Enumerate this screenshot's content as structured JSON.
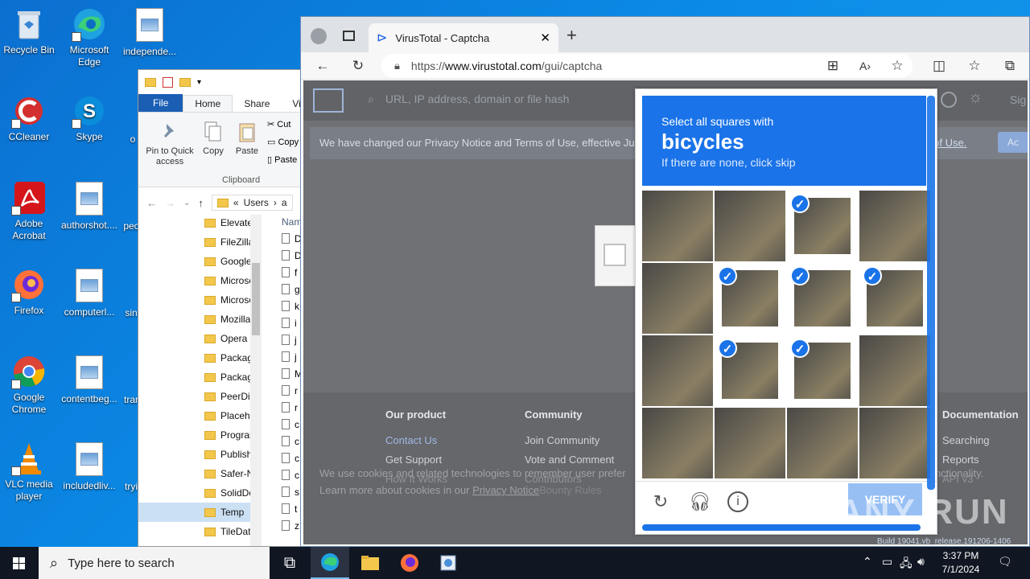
{
  "desktop": {
    "icons": [
      {
        "label": "Recycle Bin"
      },
      {
        "label": "Microsoft Edge"
      },
      {
        "label": "independe..."
      },
      {
        "label": "CCleaner"
      },
      {
        "label": "Skype"
      },
      {
        "label": "Adobe Acrobat"
      },
      {
        "label": "authorshot...."
      },
      {
        "label": "Firefox"
      },
      {
        "label": "computerl..."
      },
      {
        "label": "Google Chrome"
      },
      {
        "label": "contentbeg..."
      },
      {
        "label": "VLC media player"
      },
      {
        "label": "includedliv..."
      }
    ],
    "partial_labels": [
      "o",
      "pec",
      "sin",
      "trar",
      "tryi"
    ]
  },
  "explorer": {
    "tabs": [
      "File",
      "Home",
      "Share",
      "Vie"
    ],
    "ribbon": {
      "pin_label": "Pin to Quick access",
      "copy_label": "Copy",
      "paste_label": "Paste",
      "cut_label": "Cut",
      "copy_path_label": "Copy",
      "paste_shortcut_label": "Paste",
      "group_label": "Clipboard"
    },
    "address": {
      "prefix": "«",
      "crumb": "Users",
      "next": "a"
    },
    "nav_items": [
      "Elevate",
      "FileZilla",
      "Google",
      "Microso",
      "Microso",
      "Mozilla",
      "Opera",
      "Packag",
      "Packag",
      "PeerDis",
      "Placeho",
      "Prograr",
      "Publish",
      "Safer-N",
      "SolidDo",
      "Temp",
      "TileData"
    ],
    "selected_nav": "Temp",
    "files_header": "Nam",
    "file_letters": [
      "D",
      "D",
      "f",
      "g",
      "k",
      "i",
      "j",
      "j",
      "M",
      "r",
      "r",
      "c",
      "c",
      "c",
      "c",
      "s",
      "t",
      "z"
    ]
  },
  "browser": {
    "tab_title": "VirusTotal - Captcha",
    "url_prefix": "https://",
    "url_domain": "www.virustotal.com",
    "url_path": "/gui/captcha",
    "page": {
      "search_placeholder": "URL, IP address, domain or file hash",
      "notice": "We have changed our Privacy Notice and Terms of Use, effective Ju",
      "notice_link": "s of Use.",
      "sign": "Sig",
      "accept": "Ac",
      "footer_cols": [
        {
          "heading": "Our product",
          "items": [
            "Contact Us",
            "Get Support",
            "How It Works"
          ]
        },
        {
          "heading": "Community",
          "items": [
            "Join Community",
            "Vote and Comment",
            "Contributors"
          ]
        },
        {
          "heading": "Documentation",
          "items": [
            "Searching",
            "Reports",
            "API v3"
          ]
        }
      ],
      "cookie_line1": "We use cookies and related technologies to remember user prefer",
      "cookie_line1_tail": "functionality.",
      "cookie_line2": "Learn more about cookies in our ",
      "cookie_link": "Privacy Notice",
      "cookie_tail": "Bounty Rules"
    }
  },
  "captcha": {
    "prompt": "Select all squares with",
    "target": "bicycles",
    "hint": "If there are none, click skip",
    "tiles": [
      {
        "selected": false
      },
      {
        "selected": false
      },
      {
        "selected": true
      },
      {
        "selected": false
      },
      {
        "selected": false
      },
      {
        "selected": true
      },
      {
        "selected": true
      },
      {
        "selected": true
      },
      {
        "selected": false
      },
      {
        "selected": true
      },
      {
        "selected": true
      },
      {
        "selected": false
      },
      {
        "selected": false
      },
      {
        "selected": false
      },
      {
        "selected": false
      },
      {
        "selected": false
      }
    ],
    "check_glyph": "✓",
    "verify_label": "VERIFY"
  },
  "watermark": "ANY RUN",
  "taskbar": {
    "search_placeholder": "Type here to search",
    "time": "3:37 PM",
    "date": "7/1/2024",
    "build_text": "Build 19041.vb_release.191206-1406"
  }
}
